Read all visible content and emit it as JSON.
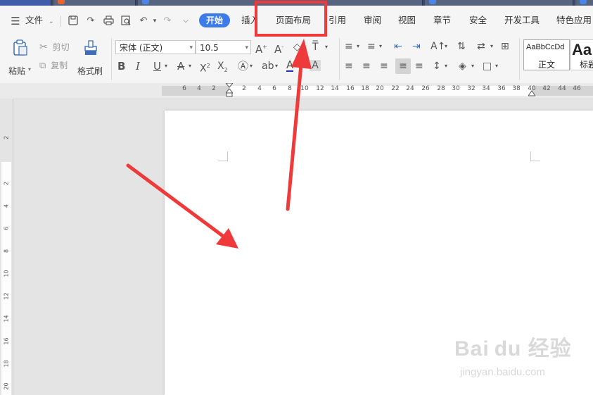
{
  "menubar": {
    "file_label": "文件",
    "tabs": [
      "开始",
      "插入",
      "页面布局",
      "引用",
      "审阅",
      "视图",
      "章节",
      "安全",
      "开发工具",
      "特色应用"
    ]
  },
  "ribbon": {
    "paste_label": "粘贴",
    "cut_label": "剪切",
    "copy_label": "复制",
    "format_painter_label": "格式刷",
    "font_name": "宋体 (正文)",
    "font_size": "10.5",
    "style_normal_preview": "AaBbCcDd",
    "style_normal_label": "正文",
    "style_heading_preview": "Aa",
    "style_heading_label": "标题"
  },
  "ruler": {
    "h_ticks": [
      "6",
      "4",
      "2",
      "2",
      "4",
      "6",
      "8",
      "10",
      "12",
      "14",
      "16",
      "18",
      "20",
      "22",
      "24",
      "26",
      "28",
      "30",
      "32",
      "34",
      "36",
      "38",
      "40",
      "42",
      "44",
      "46"
    ],
    "v_ticks": [
      "2",
      "2",
      "4",
      "6",
      "8",
      "10",
      "12",
      "14",
      "16",
      "18",
      "20"
    ]
  },
  "annotation": {
    "highlight_color": "#ee3a3a",
    "arrow_color": "#ee3a3a"
  },
  "watermark": {
    "logo": "Bai du 经验",
    "url": "jingyan.baidu.com"
  }
}
